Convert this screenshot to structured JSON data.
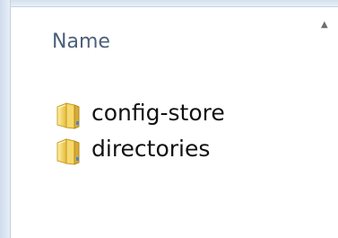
{
  "list": {
    "column_header": "Name",
    "items": [
      {
        "name": "config-store",
        "icon": "folder-icon"
      },
      {
        "name": "directories",
        "icon": "folder-icon"
      }
    ]
  },
  "colors": {
    "header_text": "#4c607a",
    "item_text": "#111111",
    "folder_yellow": "#f2c94c",
    "folder_shadow": "#caa12d",
    "folder_blue_accent": "#4a88c7",
    "window_border": "#d4e0ee"
  }
}
